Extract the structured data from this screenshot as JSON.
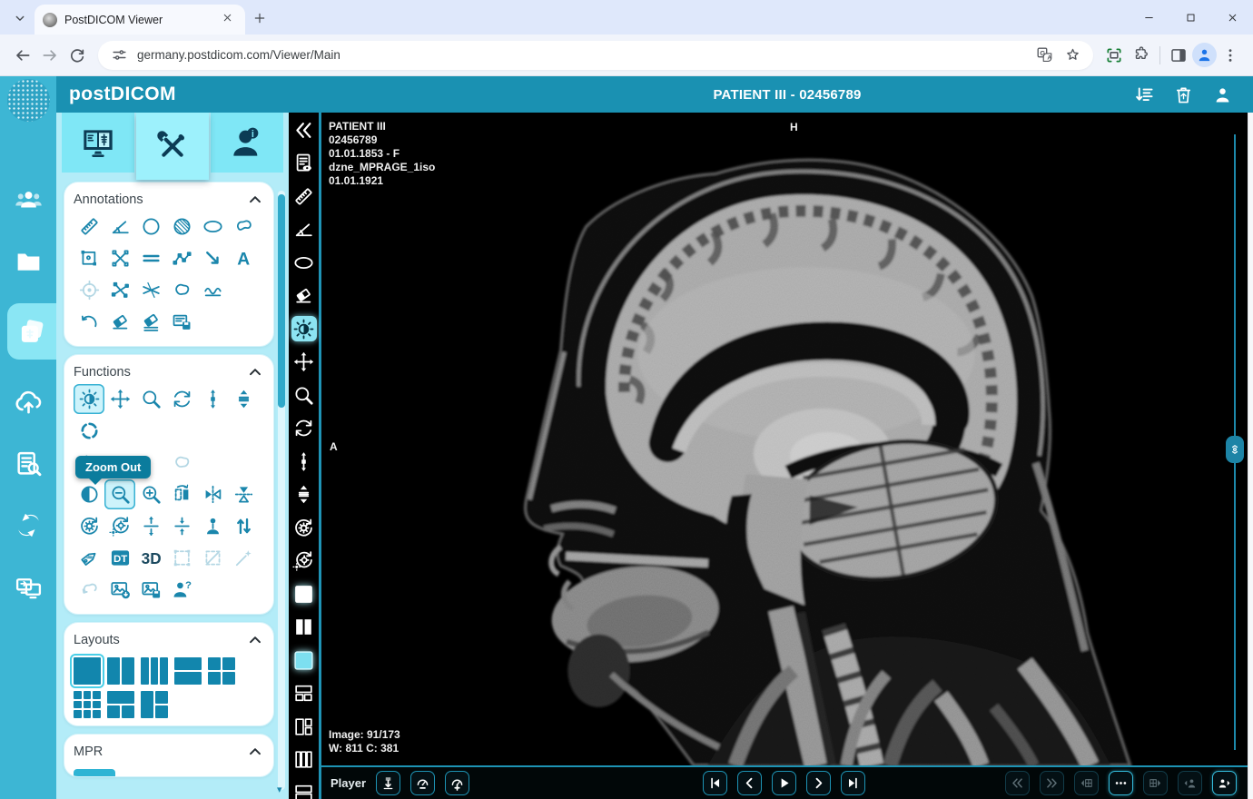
{
  "browser": {
    "tab_title": "PostDICOM Viewer",
    "url": "germany.postdicom.com/Viewer/Main",
    "icons": [
      "tab-list-chevron",
      "favicon",
      "tab-close",
      "new-tab",
      "minimize",
      "maximize",
      "close-window",
      "back",
      "forward",
      "reload",
      "site-settings",
      "translate",
      "bookmark-star",
      "screen-capture",
      "extensions",
      "side-panel",
      "profile-avatar",
      "menu-kebab"
    ]
  },
  "header": {
    "logo": "postDICOM",
    "title": "PATIENT III - 02456789",
    "actions": [
      {
        "name": "sort-series",
        "icon": "sort-list"
      },
      {
        "name": "recycle-bin",
        "icon": "trash"
      },
      {
        "name": "account",
        "icon": "user"
      }
    ]
  },
  "sidebar": {
    "items": [
      {
        "name": "patients",
        "icon": "patients"
      },
      {
        "name": "folders",
        "icon": "folders"
      },
      {
        "name": "images",
        "icon": "images",
        "selected": true
      },
      {
        "name": "upload",
        "icon": "upload"
      },
      {
        "name": "worklist",
        "icon": "worklist"
      },
      {
        "name": "sync",
        "icon": "sync"
      },
      {
        "name": "share",
        "icon": "share"
      }
    ]
  },
  "panel": {
    "tabs": [
      {
        "name": "display",
        "icon": "tab-monitor"
      },
      {
        "name": "tools",
        "icon": "tab-tools",
        "selected": true
      },
      {
        "name": "patient-info",
        "icon": "tab-person"
      }
    ],
    "annotations": {
      "title": "Annotations",
      "rows": [
        [
          {
            "name": "ruler",
            "icon": "ruler"
          },
          {
            "name": "angle",
            "icon": "angle"
          },
          {
            "name": "circle",
            "icon": "circle"
          },
          {
            "name": "shaded-circle",
            "icon": "shaded-circle"
          },
          {
            "name": "ellipse",
            "icon": "ellipse"
          },
          {
            "name": "freehand",
            "icon": "freehand"
          }
        ],
        [
          {
            "name": "rectangle",
            "icon": "rect-roi"
          },
          {
            "name": "cross-measure",
            "icon": "cross-measure"
          },
          {
            "name": "parallel-lines",
            "icon": "parallel-lines"
          },
          {
            "name": "polyline",
            "icon": "polyline"
          },
          {
            "name": "arrow",
            "icon": "arrow-se"
          },
          {
            "name": "text",
            "icon": "text-annotation"
          }
        ],
        [
          {
            "name": "point-target",
            "icon": "point-target",
            "disabled": true
          },
          {
            "name": "intersecting-lines",
            "icon": "intersect-lines"
          },
          {
            "name": "cobb-angle",
            "icon": "cobb-angle"
          },
          {
            "name": "closed-freehand",
            "icon": "closed-freehand"
          },
          {
            "name": "spline-wave",
            "icon": "wave"
          },
          {
            "empty": true
          }
        ],
        [
          {
            "name": "undo-annotation",
            "icon": "undo"
          },
          {
            "name": "erase",
            "icon": "eraser"
          },
          {
            "name": "erase-all",
            "icon": "clear-all"
          },
          {
            "name": "save-annotation",
            "icon": "save-annotation"
          },
          {
            "empty": true
          },
          {
            "empty": true
          }
        ]
      ]
    },
    "functions": {
      "title": "Functions",
      "rows": [
        [
          {
            "name": "window-level",
            "icon": "window-level",
            "selected": true
          },
          {
            "name": "pan",
            "icon": "pan"
          },
          {
            "name": "magnify",
            "icon": "magnify"
          },
          {
            "name": "rotate",
            "icon": "rotate"
          },
          {
            "name": "scroll-vertical",
            "icon": "scroll-vertical"
          },
          {
            "name": "stack-scroll",
            "icon": "stack-scroll"
          }
        ],
        [
          {
            "name": "localizer",
            "icon": "localizer"
          },
          {
            "empty": true
          },
          {
            "empty": true
          },
          {
            "empty": true
          },
          {
            "empty": true
          },
          {
            "empty": true
          }
        ],
        [
          {
            "name": "histogram",
            "icon": "histogram",
            "disabled": true
          },
          {
            "empty": true
          },
          {
            "empty": true
          },
          {
            "name": "magic-freehand",
            "icon": "magic-freehand",
            "disabled": true
          },
          {
            "empty": true
          },
          {
            "empty": true
          }
        ],
        [
          {
            "name": "invert",
            "icon": "invert"
          },
          {
            "name": "zoom-out",
            "icon": "zoom-out",
            "selected": true
          },
          {
            "name": "zoom-in",
            "icon": "zoom-in"
          },
          {
            "name": "flip-horizontal",
            "icon": "flip-horizontal"
          },
          {
            "name": "flip-vertical",
            "icon": "flip-vertical"
          },
          {
            "name": "rotate-flip",
            "icon": "rotate-flip"
          }
        ],
        [
          {
            "name": "reset-rotate",
            "icon": "reset-rotate"
          },
          {
            "name": "reset-window",
            "icon": "reset-window"
          },
          {
            "name": "expand-vertical",
            "icon": "expand-vertical"
          },
          {
            "name": "collapse-vertical",
            "icon": "collapse-vertical"
          },
          {
            "name": "patient-orientation",
            "icon": "patient-orientation"
          },
          {
            "name": "sort-order",
            "icon": "sort-vertical"
          }
        ],
        [
          {
            "name": "dicom-tag",
            "icon": "tag"
          },
          {
            "name": "dicom-dt",
            "icon": "dt-label"
          },
          {
            "name": "volume-3d",
            "icon": "three-d"
          },
          {
            "name": "select-region",
            "icon": "select-box",
            "disabled": true
          },
          {
            "name": "crop",
            "icon": "crop",
            "disabled": true
          },
          {
            "name": "magic-wand",
            "icon": "wand",
            "disabled": true
          }
        ],
        [
          {
            "name": "undo-shape",
            "icon": "undo-shape",
            "disabled": true
          },
          {
            "name": "export-image",
            "icon": "image-download"
          },
          {
            "name": "save-image",
            "icon": "image-save"
          },
          {
            "name": "anonymize",
            "icon": "user-question"
          },
          {
            "empty": true
          },
          {
            "empty": true
          }
        ]
      ]
    },
    "tooltip": {
      "text": "Zoom Out"
    },
    "layouts": {
      "title": "Layouts",
      "items": [
        {
          "name": "1x1",
          "variant": "1x1",
          "selected": true
        },
        {
          "name": "1x2",
          "variant": "1x2"
        },
        {
          "name": "1x3",
          "variant": "1x3"
        },
        {
          "name": "2x1",
          "variant": "2x1"
        },
        {
          "name": "2x2",
          "variant": "2x2"
        },
        {
          "name": "3x3",
          "variant": "3x3"
        },
        {
          "name": "1top-2bottom",
          "variant": "1t2b"
        },
        {
          "name": "1left-2right",
          "variant": "1l2r"
        }
      ]
    },
    "mpr": {
      "title": "MPR"
    }
  },
  "vtoolbar": {
    "items": [
      {
        "name": "collapse-panel",
        "icon": "collapse-left"
      },
      {
        "name": "report",
        "icon": "report-eye"
      },
      {
        "name": "ruler",
        "icon": "ruler"
      },
      {
        "name": "angle",
        "icon": "angle"
      },
      {
        "name": "ellipse",
        "icon": "ellipse"
      },
      {
        "name": "eraser",
        "icon": "eraser"
      },
      {
        "name": "window-level",
        "icon": "window-level",
        "selected": true
      },
      {
        "name": "pan",
        "icon": "pan"
      },
      {
        "name": "magnify",
        "icon": "magnify"
      },
      {
        "name": "rotate",
        "icon": "rotate"
      },
      {
        "name": "scroll-vertical",
        "icon": "scroll-vertical"
      },
      {
        "name": "stack-scroll",
        "icon": "stack-scroll"
      },
      {
        "name": "reset-rotate",
        "icon": "reset-rotate"
      },
      {
        "name": "reset-window",
        "icon": "reset-window"
      },
      {
        "name": "layout-single",
        "icon": "layout-full-white",
        "glow": true
      },
      {
        "name": "layout-2col",
        "icon": "layout-2col-white"
      },
      {
        "name": "layout-current",
        "icon": "layout-cyan",
        "glow": true
      },
      {
        "name": "layout-1top-2bottom",
        "icon": "layout-1t2b"
      },
      {
        "name": "layout-1left-2right",
        "icon": "layout-1l2r"
      },
      {
        "name": "layout-3col",
        "icon": "layout-3col"
      },
      {
        "name": "layout-2row",
        "icon": "layout-2row"
      }
    ]
  },
  "viewer": {
    "patient": [
      "PATIENT III",
      "02456789",
      "01.01.1853 - F",
      "dzne_MPRAGE_1iso",
      "01.01.1921"
    ],
    "marker_top": "H",
    "marker_left": "A",
    "image_counter": "Image: 91/173",
    "window_level": "W: 811 C: 381"
  },
  "player": {
    "label": "Player",
    "left_buttons": [
      {
        "name": "export-cine",
        "icon": "export-run"
      },
      {
        "name": "speed-down",
        "icon": "speed-minus"
      },
      {
        "name": "speed-up",
        "icon": "speed-plus"
      }
    ],
    "nav_buttons": [
      {
        "name": "first-image",
        "icon": "first-frame"
      },
      {
        "name": "previous-image",
        "icon": "prev-frame"
      },
      {
        "name": "play",
        "icon": "play"
      },
      {
        "name": "next-image",
        "icon": "next-frame"
      },
      {
        "name": "last-image",
        "icon": "last-frame"
      }
    ],
    "right_buttons": [
      {
        "name": "previous-series",
        "icon": "dbl-left",
        "disabled": true
      },
      {
        "name": "next-series",
        "icon": "dbl-right",
        "disabled": true
      },
      {
        "name": "previous-stack",
        "icon": "grid-prev",
        "disabled": true
      },
      {
        "name": "more-options",
        "icon": "more-dots",
        "bright": true
      },
      {
        "name": "next-stack",
        "icon": "grid-next",
        "disabled": true
      },
      {
        "name": "previous-patient",
        "icon": "person-prev",
        "disabled": true
      },
      {
        "name": "next-patient",
        "icon": "person-next",
        "bright": true
      }
    ]
  },
  "colors": {
    "header_teal": "#1a91b2",
    "rail_teal": "#3db6d4",
    "panel_cyan": "#b3ecf8",
    "icon_teal": "#1a86ac",
    "tooltip_teal": "#0b7c9d",
    "player_border": "#1d93b4"
  }
}
